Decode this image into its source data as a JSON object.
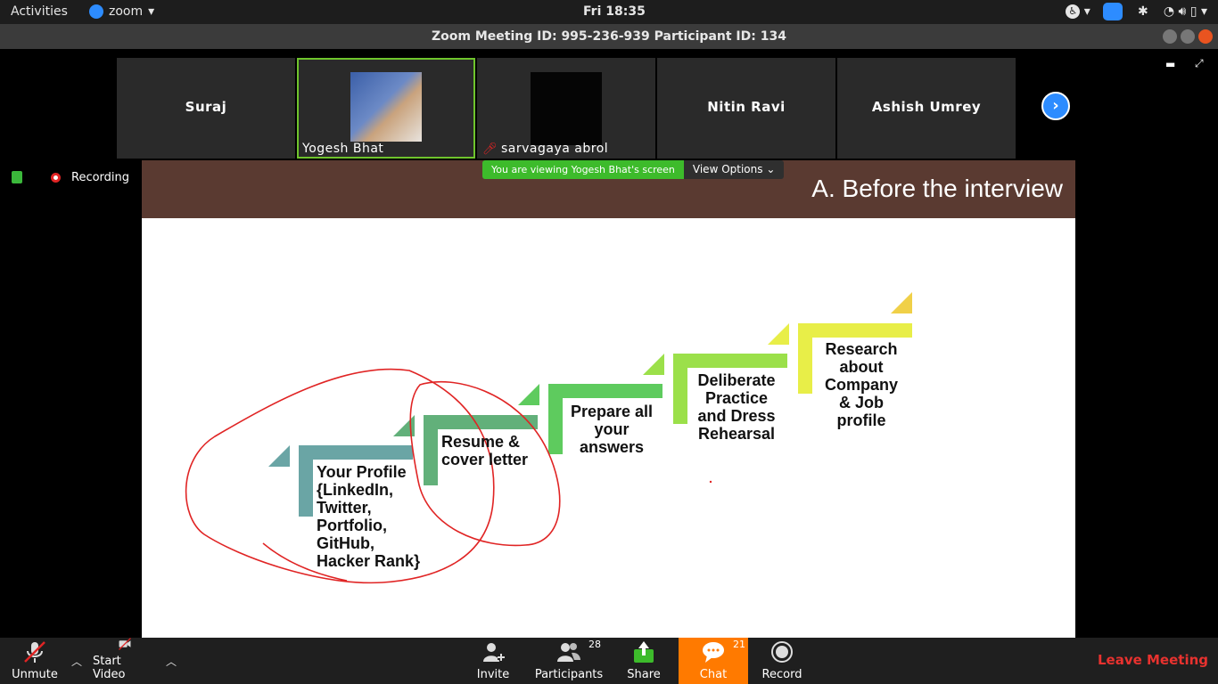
{
  "system": {
    "activities": "Activities",
    "app_name": "zoom",
    "clock": "Fri 18:35"
  },
  "window": {
    "title": "Zoom Meeting ID: 995-236-939 Participant ID: 134"
  },
  "participants_strip": [
    {
      "name": "Suraj"
    },
    {
      "name": "Yogesh Bhat"
    },
    {
      "name": "sarvagaya abrol"
    },
    {
      "name": "Nitin Ravi"
    },
    {
      "name": "Ashish Umrey"
    }
  ],
  "status": {
    "recording_label": "Recording"
  },
  "share_banner": {
    "viewing_text": "You are viewing Yogesh Bhat's screen",
    "view_options": "View Options"
  },
  "slide": {
    "title": "A. Before the interview",
    "steps": [
      {
        "label": "Your Profile {LinkedIn, Twitter, Portfolio, GitHub, Hacker Rank}",
        "color": "#6aa5a5"
      },
      {
        "label": "Resume & cover letter",
        "color": "#62b07a"
      },
      {
        "label": "Prepare all your answers",
        "color": "#5ecb5e"
      },
      {
        "label": "Deliberate Practice and Dress Rehearsal",
        "color": "#9be04a"
      },
      {
        "label": "Research about Company & Job profile",
        "color": "#e8ee48"
      }
    ],
    "lines": {
      "s1": [
        "Your Profile",
        "{LinkedIn,",
        "Twitter,",
        "Portfolio,",
        "GitHub,",
        "Hacker Rank}"
      ],
      "s2": [
        "Resume &",
        "cover letter"
      ],
      "s3": [
        "Prepare all",
        "your",
        "answers"
      ],
      "s4": [
        "Deliberate",
        "Practice",
        "and Dress",
        "Rehearsal"
      ],
      "s5": [
        "Research",
        "about",
        "Company",
        "& Job",
        "profile"
      ]
    },
    "annotation_color": "#e02424"
  },
  "toolbar": {
    "unmute": "Unmute",
    "start_video": "Start Video",
    "invite": "Invite",
    "participants": "Participants",
    "participants_count": "28",
    "share": "Share",
    "chat": "Chat",
    "chat_count": "21",
    "record": "Record",
    "leave": "Leave Meeting"
  },
  "colors": {
    "accent_blue": "#2d8cff",
    "share_green": "#3dbb2b",
    "chat_orange": "#ff7a00",
    "leave_red": "#e8322f",
    "slide_header": "#5a3a31"
  }
}
